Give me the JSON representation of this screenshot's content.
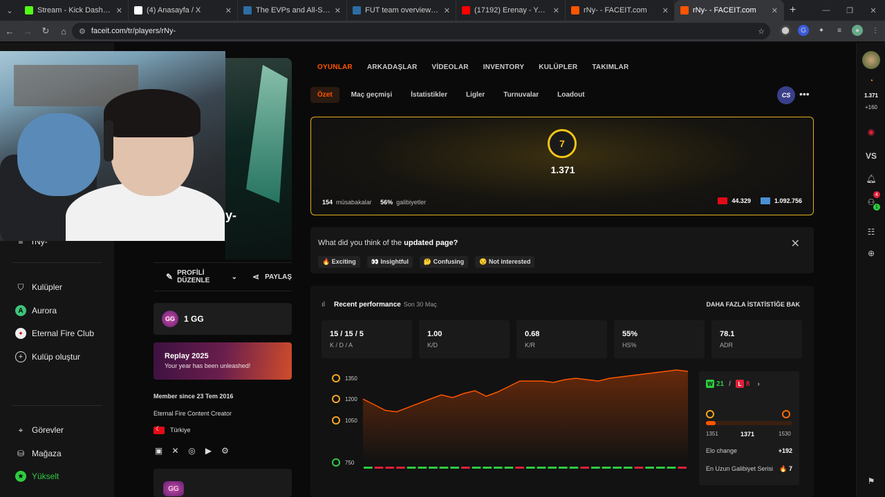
{
  "browser": {
    "tabs": [
      {
        "label": "Stream - Kick Dashboard",
        "icon": "kick-icon",
        "color": "#53fc18"
      },
      {
        "label": "(4) Anasayfa / X",
        "icon": "x-icon",
        "color": "#ffffff"
      },
      {
        "label": "The EVPs and All-Stars of StarLadder",
        "icon": "hltv-icon",
        "color": "#2d6da3"
      },
      {
        "label": "FUT team overview | HLTV.org",
        "icon": "hltv-icon",
        "color": "#2d6da3"
      },
      {
        "label": "(17192) Erenay - YouTube",
        "icon": "youtube-icon",
        "color": "#ff0000"
      },
      {
        "label": "rNy- - FACEIT.com",
        "icon": "faceit-icon",
        "color": "#ff5500"
      },
      {
        "label": "rNy- - FACEIT.com",
        "icon": "faceit-icon",
        "color": "#ff5500"
      }
    ],
    "url": "faceit.com/tr/players/rNy-"
  },
  "left_sidebar": {
    "items": [
      {
        "label": "rNy-"
      },
      {
        "label": "Kulüpler",
        "icon": "shield-icon"
      },
      {
        "label": "Aurora",
        "icon": "club-a-icon"
      },
      {
        "label": "Eternal Fire Club",
        "icon": "club-ef-icon"
      },
      {
        "label": "Kulüp oluştur",
        "icon": "plus-circle-icon"
      },
      {
        "label": "Görevler",
        "icon": "tasks-icon"
      },
      {
        "label": "Mağaza",
        "icon": "shop-icon"
      },
      {
        "label": "Yükselt",
        "icon": "star-icon"
      }
    ]
  },
  "profile": {
    "banner_text": "y-",
    "edit_label": "PROFİLİ DÜZENLE",
    "share_label": "PAYLAŞ",
    "gg_label": "1 GG",
    "gg_badge": "GG",
    "replay_title": "Replay 2025",
    "replay_sub": "Your year has been unleashed!",
    "member_since": "Member since 23 Tem 2016",
    "bio": "Eternal Fire Content Creator",
    "country": "Türkiye",
    "bottom_badge": "GG"
  },
  "nav": {
    "top": [
      "OYUNLAR",
      "ARKADAŞLAR",
      "VİDEOLAR",
      "INVENTORY",
      "KULÜPLER",
      "TAKIMLAR"
    ],
    "sub": [
      "Özet",
      "Maç geçmişi",
      "İstatistikler",
      "Ligler",
      "Turnuvalar",
      "Loadout"
    ],
    "game_logo": "CS"
  },
  "elo": {
    "level": "7",
    "value": "1.371",
    "matches": "154",
    "matches_label": "müsabakalar",
    "winrate": "56%",
    "winrate_label": "galibiyetler",
    "country_rank": "44.329",
    "global_rank": "1.092.756"
  },
  "feedback": {
    "question_prefix": "What did you think of the",
    "question_bold": "updated page?",
    "options": [
      "🔥 Exciting",
      "👀 Insightful",
      "🤔 Confusing",
      "😒 Not interested"
    ]
  },
  "performance": {
    "title": "Recent performance",
    "date": "Son 30 Maç",
    "more_link": "DAHA FAZLA İSTATİSTİĞE BAK",
    "stats": [
      {
        "value": "15 / 15 / 5",
        "label": "K / D / A"
      },
      {
        "value": "1.00",
        "label": "K/D"
      },
      {
        "value": "0.68",
        "label": "K/R"
      },
      {
        "value": "55%",
        "label": "HS%"
      },
      {
        "value": "78.1",
        "label": "ADR"
      }
    ],
    "wins": "21",
    "losses": "8",
    "elo_min": "1351",
    "elo_current": "1371",
    "elo_max": "1530",
    "elo_change_label": "Elo change",
    "elo_change": "+192",
    "streak_label": "En Uzun Galibiyet Serisi",
    "streak": "🔥 7"
  },
  "chart_data": {
    "type": "line",
    "yticks": [
      1350,
      1200,
      1050,
      750
    ],
    "ylim": [
      750,
      1400
    ],
    "values": [
      1200,
      1160,
      1120,
      1110,
      1140,
      1170,
      1200,
      1230,
      1210,
      1240,
      1260,
      1220,
      1250,
      1290,
      1330,
      1330,
      1330,
      1320,
      1340,
      1350,
      1340,
      1330,
      1350,
      1360,
      1370,
      1380,
      1390,
      1400,
      1410,
      1400
    ],
    "results": [
      "W",
      "L",
      "L",
      "L",
      "W",
      "W",
      "W",
      "W",
      "W",
      "L",
      "W",
      "W",
      "W",
      "W",
      "L",
      "W",
      "W",
      "W",
      "W",
      "W",
      "L",
      "W",
      "W",
      "W",
      "W",
      "L",
      "W",
      "W",
      "W",
      "L"
    ]
  },
  "right_sidebar": {
    "elo": "1.371",
    "delta": "+160",
    "vs_label": "VS",
    "notif_count": "4",
    "friends_count": "1",
    "ext_badge": "18"
  }
}
